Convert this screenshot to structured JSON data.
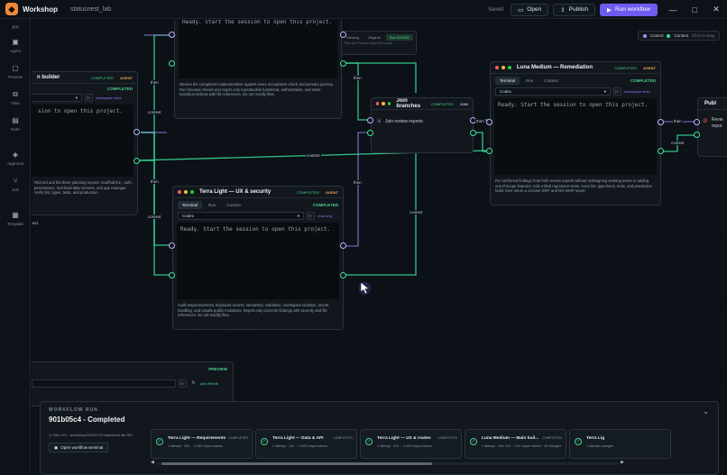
{
  "titlebar": {
    "app_name": "Workshop",
    "project": "statusnest_lab",
    "saved": "Saved",
    "open_label": "Open",
    "publish_label": "Publish",
    "run_label": "Run workflow"
  },
  "nav": {
    "search": "⌘K",
    "items": [
      {
        "label": "Agent",
        "icon": "agent-icon"
      },
      {
        "label": "Preview",
        "icon": "preview-icon"
      },
      {
        "label": "Files",
        "icon": "files-icon"
      },
      {
        "label": "Note",
        "icon": "note-icon"
      },
      {
        "label": "Approval",
        "icon": "approval-icon"
      },
      {
        "label": "Join",
        "icon": "join-icon"
      },
      {
        "label": "Template",
        "icon": "template-icon"
      }
    ]
  },
  "legend": {
    "control": "Control",
    "context": "Context",
    "hint": "Click to drag"
  },
  "view_toggle": {
    "viewing": "Viewing",
    "original": "Original",
    "run": "Run 901b05",
    "hint": "Files and Preview follow this scope"
  },
  "nodes": {
    "builder": {
      "title": "n builder",
      "badge": "COMPLETED",
      "agent": "AGENT",
      "status": "COMPLETED",
      "workspace": "workspace write",
      "terminal": "sion to open this project.",
      "desc": "R03.md and the three planning reports. Scaffold the , auth, permissions, real local data screens, and age manager. Verify lint, types, tests, and production"
    },
    "top": {
      "terminal": "Ready. Start the session to open this project.",
      "desc": "Review the completed implementation against every acceptance check and primary journey. Run focused checks and report only reproducible functional, authorization, and state-transition defects with file references. Do not modify files."
    },
    "security": {
      "title": "Terra Light — UX & security",
      "badge": "COMPLETED",
      "agent": "AGENT",
      "tab1": "Terminal",
      "tab2": "Run",
      "tab3": "Context",
      "status": "COMPLETED",
      "select": "Codex",
      "workspace": "read only",
      "terminal": "Ready. Start the session to open this project.",
      "desc": "Audit responsiveness, keyboard access, semantics, validation, workspace isolation, secret handling, and unsafe public mutations. Report only concrete findings with severity and file references. Do not modify files."
    },
    "join": {
      "title": "Join branches",
      "badge": "COMPLETED",
      "tag": "JOIN",
      "body": "Join review reports"
    },
    "remediation": {
      "title": "Luna Medium — Remediation",
      "badge": "COMPLETED",
      "agent": "AGENT",
      "tab1": "Terminal",
      "tab2": "Run",
      "tab3": "Context",
      "status": "COMPLETED",
      "select": "Codex",
      "workspace": "workspace write",
      "terminal": "Ready. Start the session to open this project.",
      "desc": "Fix confirmed findings from both review reports without redesigning working areas or adding out-of-scope features. Add critical regression tests, rerun lint, typecheck, tests, and production build, then return a concise DIFF and NO-SHIP report."
    },
    "publish": {
      "title": "Publ",
      "body1": "Revie",
      "body2": "repor"
    },
    "preview": {
      "label": "PREVIEW",
      "status": "auto fit/edit"
    }
  },
  "wire_labels": {
    "then": "then",
    "context": "context",
    "ect": "ect"
  },
  "run": {
    "label": "WORKFLOW RUN",
    "title": "901b05c4 - Completed",
    "meta": "20m 47s · workshop/20260719 statusnest lab 901",
    "open_terminal": "Open workflow terminal",
    "steps": [
      {
        "name": "Terra Light — Requirements",
        "status": "COMPLETED",
        "info": "1 attempt · 20s · ~1,280 output tokens"
      },
      {
        "name": "Terra Light — Data & API",
        "status": "COMPLETED",
        "info": "1 attempt · 14s · ~1,000 output tokens"
      },
      {
        "name": "Terra Light — UX & routes",
        "status": "COMPLETED",
        "info": "1 attempt · 47s · ~1,400 output tokens"
      },
      {
        "name": "Luna Medium — Main buil...",
        "status": "COMPLETED",
        "info": "1 attempt · 10m 21s · ~212 output tokens · 18 changed"
      },
      {
        "name": "Terra Lig",
        "status": "",
        "info": "1 attempt changed"
      }
    ]
  }
}
